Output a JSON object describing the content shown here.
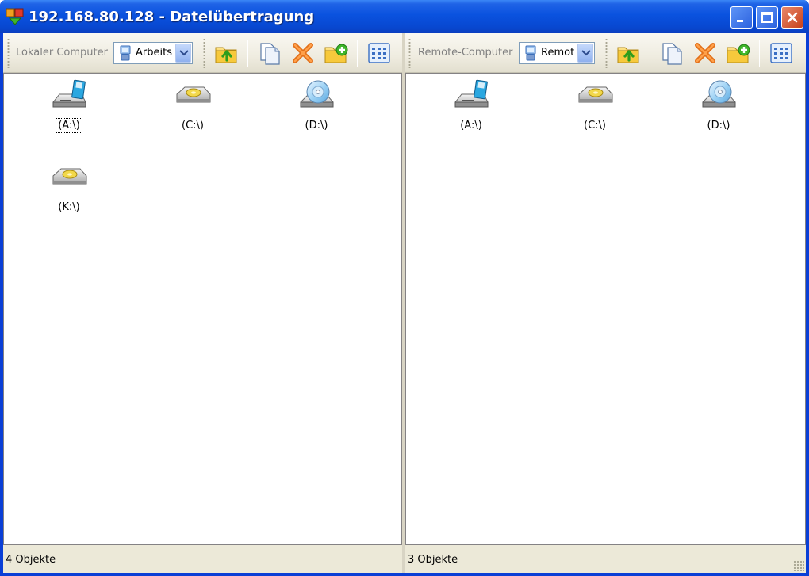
{
  "window": {
    "title": "192.168.80.128 - Dateiübertragung"
  },
  "colors": {
    "titlebar": "#0a52df",
    "client": "#ece9d8",
    "close_button": "#c6401a"
  },
  "left_pane": {
    "label": "Lokaler Computer",
    "location_combo_value": "Arbeits",
    "toolbar_icons": [
      "folder-up-icon",
      "copy-icon",
      "delete-icon",
      "new-folder-icon",
      "view-icon"
    ],
    "drives": [
      {
        "label": "(A:\\)",
        "icon": "floppy-drive-icon"
      },
      {
        "label": "(C:\\)",
        "icon": "hard-drive-icon"
      },
      {
        "label": "(D:\\)",
        "icon": "cd-drive-icon"
      },
      {
        "label": "(K:\\)",
        "icon": "hard-drive-icon"
      }
    ],
    "status": "4 Objekte"
  },
  "right_pane": {
    "label": "Remote-Computer",
    "location_combo_value": "Remot",
    "toolbar_icons": [
      "folder-up-icon",
      "copy-icon",
      "delete-icon",
      "new-folder-icon",
      "view-icon"
    ],
    "drives": [
      {
        "label": "(A:\\)",
        "icon": "floppy-drive-icon"
      },
      {
        "label": "(C:\\)",
        "icon": "hard-drive-icon"
      },
      {
        "label": "(D:\\)",
        "icon": "cd-drive-icon"
      }
    ],
    "status": "3 Objekte"
  }
}
